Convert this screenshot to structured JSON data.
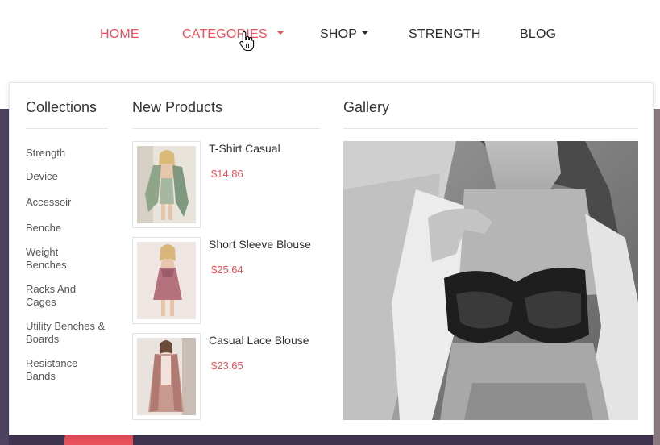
{
  "nav": {
    "items": [
      {
        "label": "HOME",
        "active": true,
        "has_caret": false
      },
      {
        "label": "CATEGORIES",
        "active": true,
        "has_caret": true
      },
      {
        "label": "SHOP",
        "active": false,
        "has_caret": true
      },
      {
        "label": "STRENGTH",
        "active": false,
        "has_caret": false
      },
      {
        "label": "BLOG",
        "active": false,
        "has_caret": false
      }
    ],
    "accent_color": "#e8505b"
  },
  "mega_menu": {
    "collections": {
      "title": "Collections",
      "items": [
        "Strength",
        "Device",
        "Accessoir",
        "Benche",
        "Weight Benches",
        "Racks And Cages",
        "Utility Benches & Boards",
        "Resistance Bands"
      ]
    },
    "new_products": {
      "title": "New Products",
      "items": [
        {
          "name": "T-Shirt Casual",
          "price": "$14.86"
        },
        {
          "name": "Short Sleeve Blouse",
          "price": "$25.64"
        },
        {
          "name": "Casual Lace Blouse",
          "price": "$23.65"
        }
      ]
    },
    "gallery": {
      "title": "Gallery"
    }
  },
  "icons": {
    "cursor": "hand-pointer-icon",
    "caret": "caret-down-icon"
  }
}
